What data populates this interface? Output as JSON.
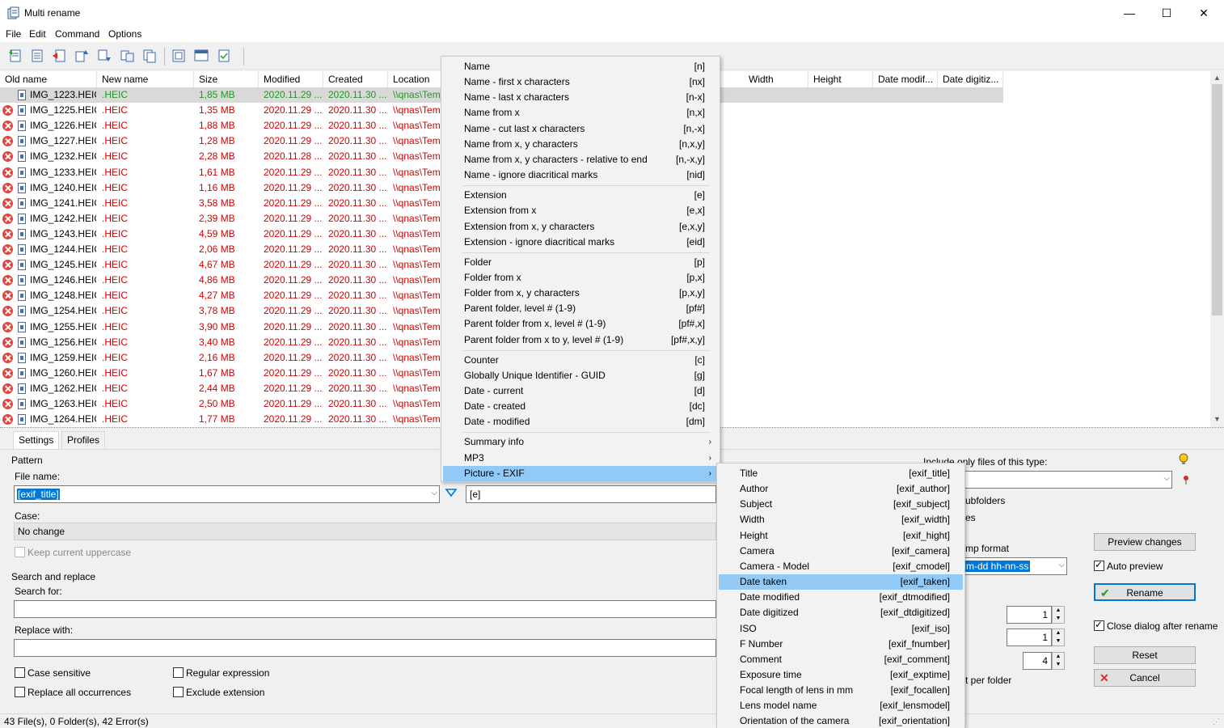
{
  "window": {
    "title": "Multi rename",
    "minimize": "—",
    "maximize": "☐",
    "close": "✕"
  },
  "menubar": [
    "File",
    "Edit",
    "Command",
    "Options"
  ],
  "toolbar_icons": [
    "add-files-icon",
    "add-folder-icon",
    "remove-icon",
    "move-up-icon",
    "move-down-icon",
    "swap-icon",
    "copy-icon",
    "open-list-icon",
    "preview-icon",
    "check-icon"
  ],
  "columns": [
    "Old name",
    "New name",
    "Size",
    "Modified",
    "Created",
    "Location",
    "Width",
    "Height",
    "Date modif...",
    "Date digitiz..."
  ],
  "rows": [
    {
      "old": "IMG_1223.HEIC",
      "new": ".HEIC",
      "size": "1,85 MB",
      "modified": "2020.11.29 ...",
      "created": "2020.11.30 ...",
      "location": "\\\\qnas\\Tem",
      "error": false
    },
    {
      "old": "IMG_1225.HEIC",
      "new": ".HEIC",
      "size": "1,35 MB",
      "modified": "2020.11.29 ...",
      "created": "2020.11.30 ...",
      "location": "\\\\qnas\\Tem",
      "error": true
    },
    {
      "old": "IMG_1226.HEIC",
      "new": ".HEIC",
      "size": "1,88 MB",
      "modified": "2020.11.29 ...",
      "created": "2020.11.30 ...",
      "location": "\\\\qnas\\Tem",
      "error": true
    },
    {
      "old": "IMG_1227.HEIC",
      "new": ".HEIC",
      "size": "1,28 MB",
      "modified": "2020.11.29 ...",
      "created": "2020.11.30 ...",
      "location": "\\\\qnas\\Tem",
      "error": true
    },
    {
      "old": "IMG_1232.HEIC",
      "new": ".HEIC",
      "size": "2,28 MB",
      "modified": "2020.11.28 ...",
      "created": "2020.11.30 ...",
      "location": "\\\\qnas\\Tem",
      "error": true
    },
    {
      "old": "IMG_1233.HEIC",
      "new": ".HEIC",
      "size": "1,61 MB",
      "modified": "2020.11.29 ...",
      "created": "2020.11.30 ...",
      "location": "\\\\qnas\\Tem",
      "error": true
    },
    {
      "old": "IMG_1240.HEIC",
      "new": ".HEIC",
      "size": "1,16 MB",
      "modified": "2020.11.29 ...",
      "created": "2020.11.30 ...",
      "location": "\\\\qnas\\Tem",
      "error": true
    },
    {
      "old": "IMG_1241.HEIC",
      "new": ".HEIC",
      "size": "3,58 MB",
      "modified": "2020.11.29 ...",
      "created": "2020.11.30 ...",
      "location": "\\\\qnas\\Tem",
      "error": true
    },
    {
      "old": "IMG_1242.HEIC",
      "new": ".HEIC",
      "size": "2,39 MB",
      "modified": "2020.11.29 ...",
      "created": "2020.11.30 ...",
      "location": "\\\\qnas\\Tem",
      "error": true
    },
    {
      "old": "IMG_1243.HEIC",
      "new": ".HEIC",
      "size": "4,59 MB",
      "modified": "2020.11.29 ...",
      "created": "2020.11.30 ...",
      "location": "\\\\qnas\\Tem",
      "error": true
    },
    {
      "old": "IMG_1244.HEIC",
      "new": ".HEIC",
      "size": "2,06 MB",
      "modified": "2020.11.29 ...",
      "created": "2020.11.30 ...",
      "location": "\\\\qnas\\Tem",
      "error": true
    },
    {
      "old": "IMG_1245.HEIC",
      "new": ".HEIC",
      "size": "4,67 MB",
      "modified": "2020.11.29 ...",
      "created": "2020.11.30 ...",
      "location": "\\\\qnas\\Tem",
      "error": true
    },
    {
      "old": "IMG_1246.HEIC",
      "new": ".HEIC",
      "size": "4,86 MB",
      "modified": "2020.11.29 ...",
      "created": "2020.11.30 ...",
      "location": "\\\\qnas\\Tem",
      "error": true
    },
    {
      "old": "IMG_1248.HEIC",
      "new": ".HEIC",
      "size": "4,27 MB",
      "modified": "2020.11.29 ...",
      "created": "2020.11.30 ...",
      "location": "\\\\qnas\\Tem",
      "error": true
    },
    {
      "old": "IMG_1254.HEIC",
      "new": ".HEIC",
      "size": "3,78 MB",
      "modified": "2020.11.29 ...",
      "created": "2020.11.30 ...",
      "location": "\\\\qnas\\Tem",
      "error": true
    },
    {
      "old": "IMG_1255.HEIC",
      "new": ".HEIC",
      "size": "3,90 MB",
      "modified": "2020.11.29 ...",
      "created": "2020.11.30 ...",
      "location": "\\\\qnas\\Tem",
      "error": true
    },
    {
      "old": "IMG_1256.HEIC",
      "new": ".HEIC",
      "size": "3,40 MB",
      "modified": "2020.11.29 ...",
      "created": "2020.11.30 ...",
      "location": "\\\\qnas\\Tem",
      "error": true
    },
    {
      "old": "IMG_1259.HEIC",
      "new": ".HEIC",
      "size": "2,16 MB",
      "modified": "2020.11.29 ...",
      "created": "2020.11.30 ...",
      "location": "\\\\qnas\\Tem",
      "error": true
    },
    {
      "old": "IMG_1260.HEIC",
      "new": ".HEIC",
      "size": "1,67 MB",
      "modified": "2020.11.29 ...",
      "created": "2020.11.30 ...",
      "location": "\\\\qnas\\Tem",
      "error": true
    },
    {
      "old": "IMG_1262.HEIC",
      "new": ".HEIC",
      "size": "2,44 MB",
      "modified": "2020.11.29 ...",
      "created": "2020.11.30 ...",
      "location": "\\\\qnas\\Tem",
      "error": true
    },
    {
      "old": "IMG_1263.HEIC",
      "new": ".HEIC",
      "size": "2,50 MB",
      "modified": "2020.11.29 ...",
      "created": "2020.11.30 ...",
      "location": "\\\\qnas\\Tem",
      "error": true
    },
    {
      "old": "IMG_1264.HEIC",
      "new": ".HEIC",
      "size": "1,77 MB",
      "modified": "2020.11.29 ...",
      "created": "2020.11.30 ...",
      "location": "\\\\qnas\\Tem",
      "error": true
    }
  ],
  "tabs": [
    "Settings",
    "Profiles"
  ],
  "settings": {
    "pattern_label": "Pattern",
    "file_name_label": "File name:",
    "file_name_value": "[exif_title]",
    "ext_value": "[e]",
    "case_label": "Case:",
    "case_value": "No change",
    "keep_uppercase": "Keep current uppercase",
    "search_replace_label": "Search and replace",
    "search_for_label": "Search for:",
    "replace_with_label": "Replace with:",
    "case_sensitive": "Case sensitive",
    "regular_expression": "Regular expression",
    "replace_all": "Replace all occurrences",
    "exclude_extension": "Exclude extension",
    "include_only": "Include only files of this type:",
    "subfolders_frag": "ubfolders",
    "es_frag": "es",
    "date_format_frag": "mp format",
    "date_format_value": "m-dd hh-nn-ss",
    "per_folder_frag": "t per folder",
    "spin1": "1",
    "spin2": "1",
    "spin3": "4",
    "preview_changes": "Preview changes",
    "auto_preview": "Auto preview",
    "rename": "Rename",
    "close_dialog": "Close dialog after rename",
    "reset": "Reset",
    "cancel": "Cancel"
  },
  "status": "43 File(s), 0 Folder(s), 42 Error(s)",
  "menu1": [
    {
      "label": "Name",
      "code": "[n]"
    },
    {
      "label": "Name - first x characters",
      "code": "[nx]"
    },
    {
      "label": "Name - last x characters",
      "code": "[n-x]"
    },
    {
      "label": "Name from x",
      "code": "[n,x]"
    },
    {
      "label": "Name - cut last x characters",
      "code": "[n,-x]"
    },
    {
      "label": "Name from x, y characters",
      "code": "[n,x,y]"
    },
    {
      "label": "Name from x, y characters - relative to end",
      "code": "[n,-x,y]"
    },
    {
      "label": "Name - ignore diacritical marks",
      "code": "[nid]"
    },
    {
      "sep": true
    },
    {
      "label": "Extension",
      "code": "[e]"
    },
    {
      "label": "Extension from x",
      "code": "[e,x]"
    },
    {
      "label": "Extension from x, y characters",
      "code": "[e,x,y]"
    },
    {
      "label": "Extension - ignore diacritical marks",
      "code": "[eid]"
    },
    {
      "sep": true
    },
    {
      "label": "Folder",
      "code": "[p]"
    },
    {
      "label": "Folder from x",
      "code": "[p,x]"
    },
    {
      "label": "Folder from x, y characters",
      "code": "[p,x,y]"
    },
    {
      "label": "Parent folder, level # (1-9)",
      "code": "[pf#]"
    },
    {
      "label": "Parent folder from x, level # (1-9)",
      "code": "[pf#,x]"
    },
    {
      "label": "Parent folder from x to y, level # (1-9)",
      "code": "[pf#,x,y]"
    },
    {
      "sep": true
    },
    {
      "label": "Counter",
      "code": "[c]"
    },
    {
      "label": "Globally Unique Identifier - GUID",
      "code": "[g]"
    },
    {
      "label": "Date - current",
      "code": "[d]"
    },
    {
      "label": "Date - created",
      "code": "[dc]"
    },
    {
      "label": "Date - modified",
      "code": "[dm]"
    },
    {
      "sep": true
    },
    {
      "label": "Summary info",
      "code": "",
      "sub": true
    },
    {
      "label": "MP3",
      "code": "",
      "sub": true
    },
    {
      "label": "Picture - EXIF",
      "code": "",
      "sub": true,
      "hl": true
    }
  ],
  "menu2": [
    {
      "label": "Title",
      "code": "[exif_title]"
    },
    {
      "label": "Author",
      "code": "[exif_author]"
    },
    {
      "label": "Subject",
      "code": "[exif_subject]"
    },
    {
      "label": "Width",
      "code": "[exif_width]"
    },
    {
      "label": "Height",
      "code": "[exif_hight]"
    },
    {
      "label": "Camera",
      "code": "[exif_camera]"
    },
    {
      "label": "Camera - Model",
      "code": "[exif_cmodel]"
    },
    {
      "label": "Date taken",
      "code": "[exif_taken]",
      "hl": true
    },
    {
      "label": "Date modified",
      "code": "[exif_dtmodified]"
    },
    {
      "label": "Date digitized",
      "code": "[exif_dtdigitized]"
    },
    {
      "label": "ISO",
      "code": "[exif_iso]"
    },
    {
      "label": "F Number",
      "code": "[exif_fnumber]"
    },
    {
      "label": "Comment",
      "code": "[exif_comment]"
    },
    {
      "label": "Exposure time",
      "code": "[exif_exptime]"
    },
    {
      "label": "Focal length of lens in mm",
      "code": "[exif_focallen]"
    },
    {
      "label": "Lens model name",
      "code": "[exif_lensmodel]"
    },
    {
      "label": "Orientation of the camera",
      "code": "[exif_orientation]"
    }
  ]
}
